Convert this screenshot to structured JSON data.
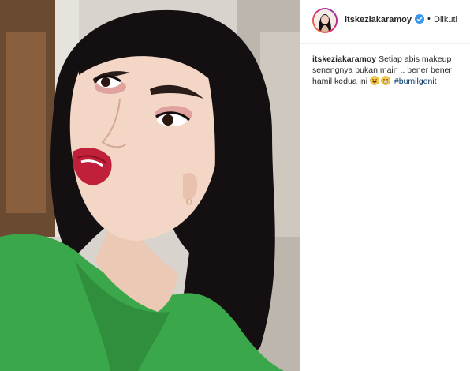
{
  "post": {
    "username": "itskeziakaramoy",
    "follow_status": "Diikuti",
    "separator": "•",
    "caption": {
      "username": "itskeziakaramoy",
      "text": "Setiap abis makeup senengnya bukan main .. bener bener hamil kedua ini",
      "emojis": [
        "rofl-emoji-icon",
        "grimace-emoji-icon"
      ],
      "hashtag": "#bumilgenit"
    },
    "icons": {
      "verified": "verified-badge-icon",
      "avatar": "profile-avatar"
    },
    "colors": {
      "verified_blue": "#3897f0",
      "hashtag": "#003569",
      "text": "#262626",
      "shirt_green": "#3aa84a"
    }
  }
}
